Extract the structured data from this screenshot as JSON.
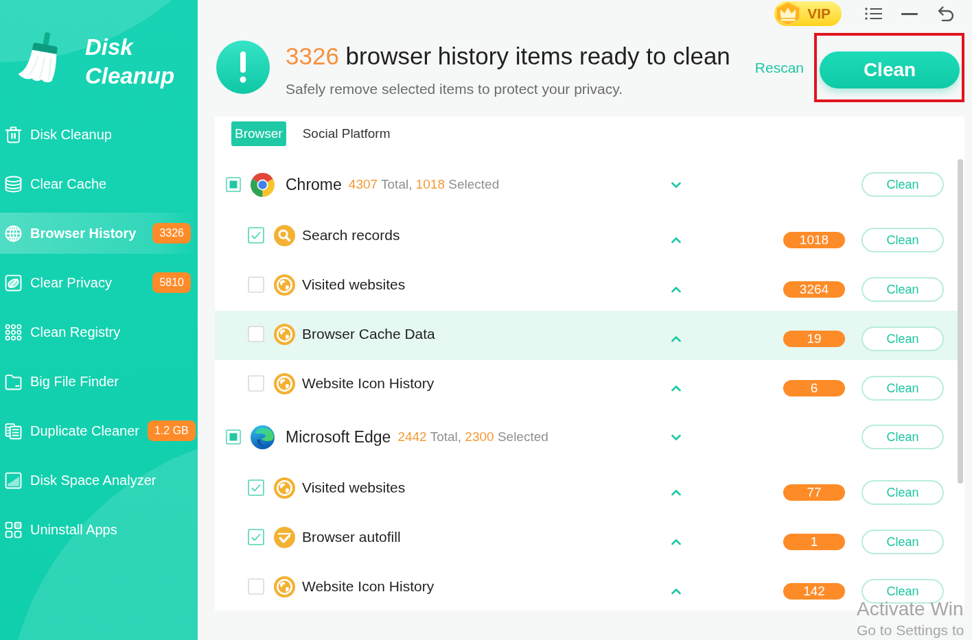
{
  "sidebar": {
    "app_title": "Disk Cleanup",
    "items": [
      {
        "label": "Disk Cleanup",
        "selected": false
      },
      {
        "label": "Clear Cache",
        "selected": false
      },
      {
        "label": "Browser History",
        "selected": true,
        "badge": "3326"
      },
      {
        "label": "Clear Privacy",
        "selected": false,
        "badge": "5810"
      },
      {
        "label": "Clean Registry",
        "selected": false
      },
      {
        "label": "Big File Finder",
        "selected": false
      },
      {
        "label": "Duplicate Cleaner",
        "selected": false,
        "badge": "1.2 GB"
      },
      {
        "label": "Disk Space Analyzer",
        "selected": false
      },
      {
        "label": "Uninstall Apps",
        "selected": false
      }
    ]
  },
  "top_bar": {
    "vip": "VIP"
  },
  "header": {
    "count": "3326",
    "title": "browser history items ready to clean",
    "subtitle": "Safely remove selected items to protect your privacy.",
    "rescan": "Rescan",
    "clean_button": {
      "label": "Clean",
      "highlighted": true
    }
  },
  "tabs": [
    {
      "label": "Browser",
      "selected": true
    },
    {
      "label": "Social Platform",
      "selected": false
    }
  ],
  "browsers": [
    {
      "kind": "chrome",
      "name": "Chrome",
      "total": "4307",
      "total_label": "Total,",
      "selected_count": "1018",
      "selected_label": "Selected",
      "indeterminate": true,
      "expanded": true,
      "action": "Clean",
      "items": [
        {
          "kind": "search",
          "name": "Search records",
          "checked": true,
          "expanded": false,
          "highlighted": false,
          "count": "1018",
          "action": "Clean"
        },
        {
          "kind": "globe",
          "name": "Visited websites",
          "checked": false,
          "expanded": false,
          "highlighted": false,
          "count": "3264",
          "action": "Clean"
        },
        {
          "kind": "globe",
          "name": "Browser Cache Data",
          "checked": false,
          "expanded": false,
          "highlighted": true,
          "count": "19",
          "action": "Clean"
        },
        {
          "kind": "globe",
          "name": "Website Icon History",
          "checked": false,
          "expanded": false,
          "highlighted": false,
          "count": "6",
          "action": "Clean"
        }
      ]
    },
    {
      "kind": "edge",
      "name": "Microsoft Edge",
      "total": "2442",
      "total_label": "Total,",
      "selected_count": "2300",
      "selected_label": "Selected",
      "indeterminate": true,
      "expanded": true,
      "action": "Clean",
      "items": [
        {
          "kind": "globe",
          "name": "Visited websites",
          "checked": true,
          "expanded": false,
          "highlighted": false,
          "count": "77",
          "action": "Clean"
        },
        {
          "kind": "autofill",
          "name": "Browser autofill",
          "checked": true,
          "expanded": false,
          "highlighted": false,
          "count": "1",
          "action": "Clean"
        },
        {
          "kind": "globe",
          "name": "Website Icon History",
          "checked": false,
          "expanded": false,
          "highlighted": false,
          "count": "142",
          "action": "Clean"
        }
      ]
    }
  ],
  "os_notice": {
    "title": "Activate Win",
    "subtitle": "Go to Settings to"
  }
}
